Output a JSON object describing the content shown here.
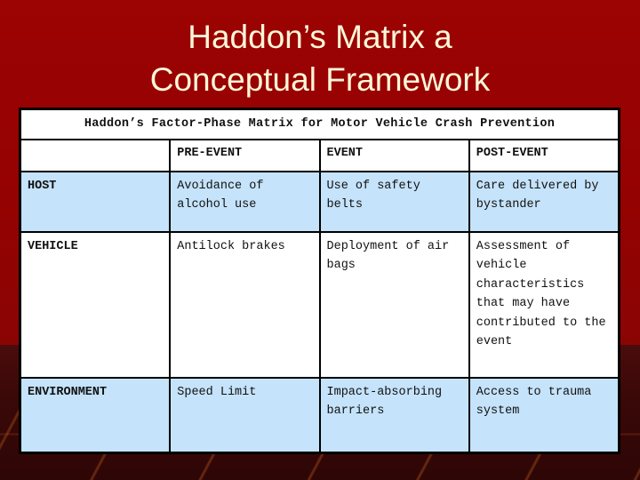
{
  "slide": {
    "title_line1": "Haddon’s Matrix a",
    "title_line2": "Conceptual Framework",
    "background_color": "#990000",
    "background_bottom_color": "#3a0808",
    "title_color": "#FDF6D8"
  },
  "table": {
    "caption": "Haddon’s Factor-Phase Matrix for Motor Vehicle Crash Prevention",
    "caption_bg": "#0A0A6E",
    "caption_color": "#FFFFFF",
    "shaded_row_color": "#C5E3FA",
    "plain_row_color": "#FFFFFF",
    "border_color": "#000000",
    "columns": [
      "",
      "PRE-EVENT",
      "EVENT",
      "POST-EVENT"
    ],
    "rows": [
      {
        "label": "HOST",
        "shaded": true,
        "cells": [
          "Avoidance of alcohol use",
          "Use of safety belts",
          "Care delivered by bystander"
        ]
      },
      {
        "label": "VEHICLE",
        "shaded": false,
        "cells": [
          "Antilock brakes",
          "Deployment of air bags",
          "Assessment of vehicle characteristics that may have contributed to the event"
        ]
      },
      {
        "label": "ENVIRONMENT",
        "shaded": true,
        "cells": [
          "Speed Limit",
          "Impact-absorbing barriers",
          "Access to trauma system"
        ]
      }
    ]
  }
}
